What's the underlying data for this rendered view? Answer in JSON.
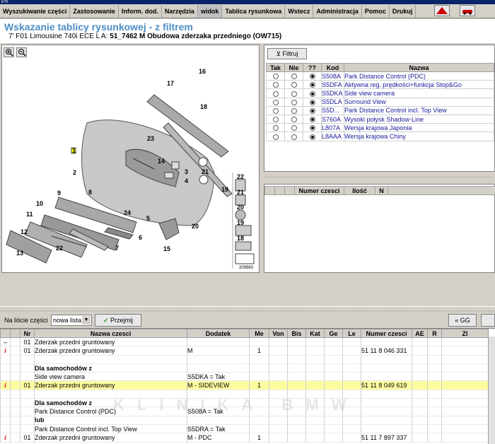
{
  "window": {
    "title": "ETK"
  },
  "menu": [
    "Wyszukiwanie części",
    "Zastosowanie",
    "Inform. dod.",
    "Narzędzia",
    "widok",
    "Tablica rysunkowa",
    "Wstecz",
    "Administracja",
    "Pomoc",
    "Drukuj"
  ],
  "header": {
    "title": "Wskazanie tablicy rysunkowej - z filtrem",
    "subtitle_prefix": "7' F01 Limousine 740i ECE  L A:",
    "subtitle_bold": "51_7462 M Obudowa zderzaka przedniego (OW715)"
  },
  "diagram": {
    "callouts": [
      "16",
      "17",
      "18",
      "23",
      "14",
      "3",
      "4",
      "21",
      "1",
      "2",
      "19",
      "9",
      "8",
      "11",
      "10",
      "24",
      "5",
      "12",
      "6",
      "7",
      "22",
      "13",
      "20",
      "15"
    ],
    "side_numbers": [
      "22",
      "21",
      "20",
      "19",
      "18"
    ],
    "image_number": "209963"
  },
  "filter": {
    "button_label": "Filtruj",
    "columns": [
      "Tak",
      "Nie",
      "??",
      "Kod",
      "Nazwa"
    ],
    "rows": [
      {
        "kod": "S508A",
        "nazwa": "Park Distance Control (PDC)"
      },
      {
        "kod": "S5DFA",
        "nazwa": "Aktywna reg. prędkości+funkcja Stop&Go"
      },
      {
        "kod": "S5DKA",
        "nazwa": "Side view camera"
      },
      {
        "kod": "S5DLA",
        "nazwa": "Surround View"
      },
      {
        "kod": "S5D...",
        "nazwa": "Park Distance Control incl. Top View"
      },
      {
        "kod": "S760A",
        "nazwa": "Wysoki połysk Shadow-Line"
      },
      {
        "kod": "L807A",
        "nazwa": "Wersja krajowa Japonia"
      },
      {
        "kod": "L8AAA",
        "nazwa": "Wersja krajowa Chiny"
      }
    ]
  },
  "parts_list": {
    "columns": [
      "Numer czesci",
      "Ilość",
      "N"
    ]
  },
  "bottom_toolbar": {
    "label": "Na liście części",
    "select_value": "nowa lista",
    "accept_label": "Przejmij",
    "gg_label": "GG"
  },
  "main_table": {
    "columns": [
      "Nr",
      "Nazwa czesci",
      "Dodatek",
      "Me",
      "Von",
      "Bis",
      "Kat",
      "Ge",
      "Le",
      "Numer czesci",
      "AE",
      "R",
      "Zl"
    ],
    "rows": [
      {
        "marker": "–",
        "nr": "01",
        "nazwa": "Zderzak przedni gruntowany",
        "dodatek": "",
        "me": "",
        "numer": "",
        "type": "group"
      },
      {
        "marker": "i",
        "nr": "01",
        "nazwa": "Zderzak przedni gruntowany",
        "dodatek": "M",
        "me": "1",
        "numer": "51 11 8 046 331",
        "type": "part"
      },
      {
        "marker": "",
        "nr": "",
        "nazwa": "",
        "dodatek": "",
        "me": "",
        "numer": "",
        "type": "empty"
      },
      {
        "marker": "",
        "nr": "",
        "nazwa": "Dla samochodów z",
        "dodatek": "",
        "me": "",
        "numer": "",
        "type": "bold"
      },
      {
        "marker": "",
        "nr": "",
        "nazwa": "Side view camera",
        "dodatek": "S5DKA = Tak",
        "me": "",
        "numer": "",
        "type": "cond"
      },
      {
        "marker": "i",
        "nr": "01",
        "nazwa": "Zderzak przedni gruntowany",
        "dodatek": "M - SIDEVIEW",
        "me": "1",
        "numer": "51 11 8 049 619",
        "type": "hl"
      },
      {
        "marker": "",
        "nr": "",
        "nazwa": "",
        "dodatek": "",
        "me": "",
        "numer": "",
        "type": "empty"
      },
      {
        "marker": "",
        "nr": "",
        "nazwa": "Dla samochodów z",
        "dodatek": "",
        "me": "",
        "numer": "",
        "type": "bold"
      },
      {
        "marker": "",
        "nr": "",
        "nazwa": "Park Distance Control (PDC)",
        "dodatek": "S508A = Tak",
        "me": "",
        "numer": "",
        "type": "cond"
      },
      {
        "marker": "",
        "nr": "",
        "nazwa": "lub",
        "dodatek": "",
        "me": "",
        "numer": "",
        "type": "bold"
      },
      {
        "marker": "",
        "nr": "",
        "nazwa": "Park Distance Control incl. Top View",
        "dodatek": "S5DRA = Tak",
        "me": "",
        "numer": "",
        "type": "cond"
      },
      {
        "marker": "i",
        "nr": "01",
        "nazwa": "Zderzak przedni gruntowany",
        "dodatek": "M - PDC",
        "me": "1",
        "numer": "51 11 7 897 337",
        "type": "part"
      }
    ]
  },
  "watermark": "KLINIKA  BMW"
}
